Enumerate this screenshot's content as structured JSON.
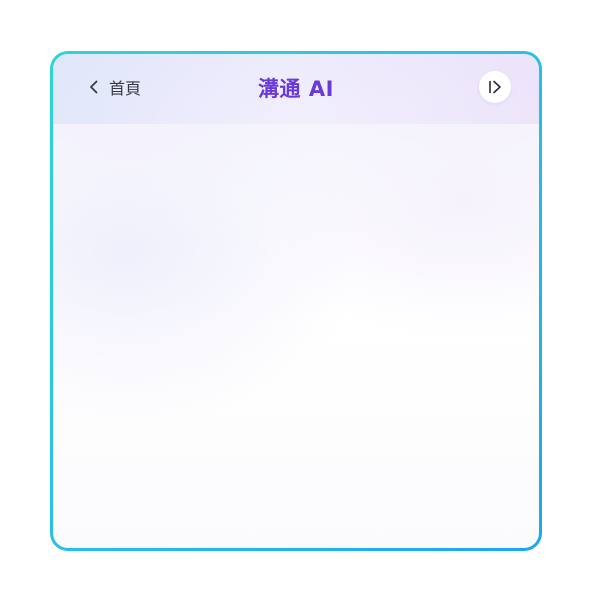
{
  "header": {
    "back_label": "首頁",
    "title": "溝通 AI",
    "back_icon": "chevron-left-icon",
    "collapse_icon": "sidebar-collapse-icon"
  },
  "colors": {
    "frame_start": "#2fd6d0",
    "frame_end": "#1aa8f0",
    "title": "#6a3ad8"
  }
}
